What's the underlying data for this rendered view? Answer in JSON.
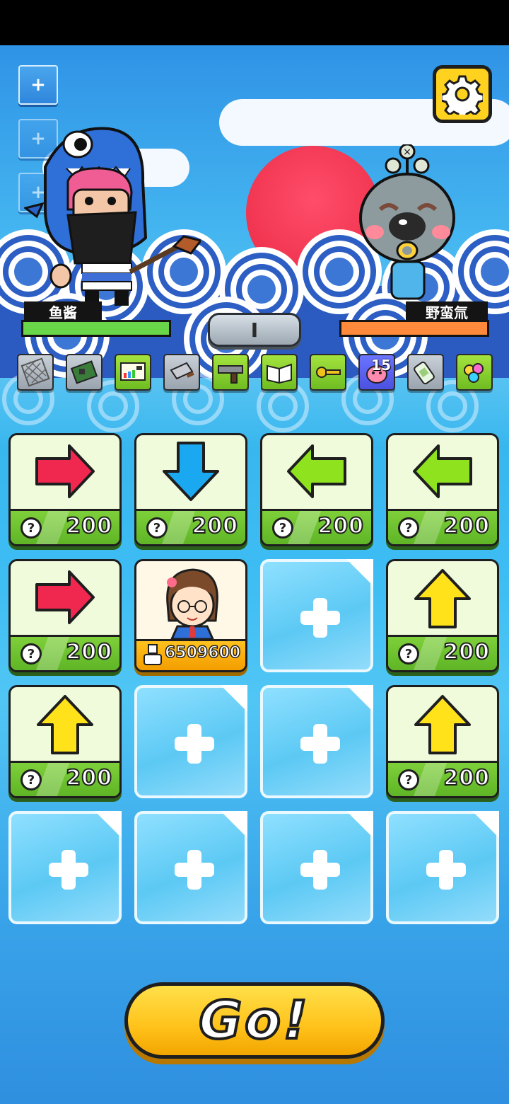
{
  "header": {
    "side_buttons": [
      "+",
      "+",
      "+"
    ],
    "settings_icon": "gear-icon"
  },
  "battle": {
    "player": {
      "name": "鱼酱",
      "hp_fraction": 1.0,
      "hp_color": "#69d64a"
    },
    "enemy": {
      "name": "野蛮氚",
      "hp_fraction": 1.0,
      "hp_color": "#ff8a3c"
    },
    "round": "I"
  },
  "items": [
    {
      "icon": "net-icon",
      "style": "grey"
    },
    {
      "icon": "circuit-board-icon",
      "style": "grey"
    },
    {
      "icon": "color-palette-card-icon",
      "style": "green"
    },
    {
      "icon": "cleaver-icon",
      "style": "grey"
    },
    {
      "icon": "gun-icon",
      "style": "green"
    },
    {
      "icon": "book-icon",
      "style": "green"
    },
    {
      "icon": "key-icon",
      "style": "green"
    },
    {
      "icon": "pink-blob-icon",
      "style": "purple",
      "count": "15"
    },
    {
      "icon": "bandage-icon",
      "style": "grey"
    },
    {
      "icon": "gems-icon",
      "style": "green"
    }
  ],
  "grid": {
    "cells": [
      {
        "type": "shop",
        "arrow": "right",
        "color": "#f0284f",
        "price": "200"
      },
      {
        "type": "shop",
        "arrow": "down",
        "color": "#1aa8f0",
        "price": "200"
      },
      {
        "type": "shop",
        "arrow": "left",
        "color": "#8fe31e",
        "price": "200"
      },
      {
        "type": "shop",
        "arrow": "left",
        "color": "#8fe31e",
        "price": "200"
      },
      {
        "type": "shop",
        "arrow": "right",
        "color": "#f0284f",
        "price": "200"
      },
      {
        "type": "player",
        "score": "6509600"
      },
      {
        "type": "empty"
      },
      {
        "type": "shop",
        "arrow": "up",
        "color": "#ffe21a",
        "price": "200"
      },
      {
        "type": "shop",
        "arrow": "up",
        "color": "#ffe21a",
        "price": "200"
      },
      {
        "type": "empty"
      },
      {
        "type": "empty"
      },
      {
        "type": "shop",
        "arrow": "up",
        "color": "#ffe21a",
        "price": "200"
      },
      {
        "type": "empty"
      },
      {
        "type": "empty"
      },
      {
        "type": "empty"
      },
      {
        "type": "empty"
      }
    ]
  },
  "go_button": {
    "label": "Go!"
  }
}
